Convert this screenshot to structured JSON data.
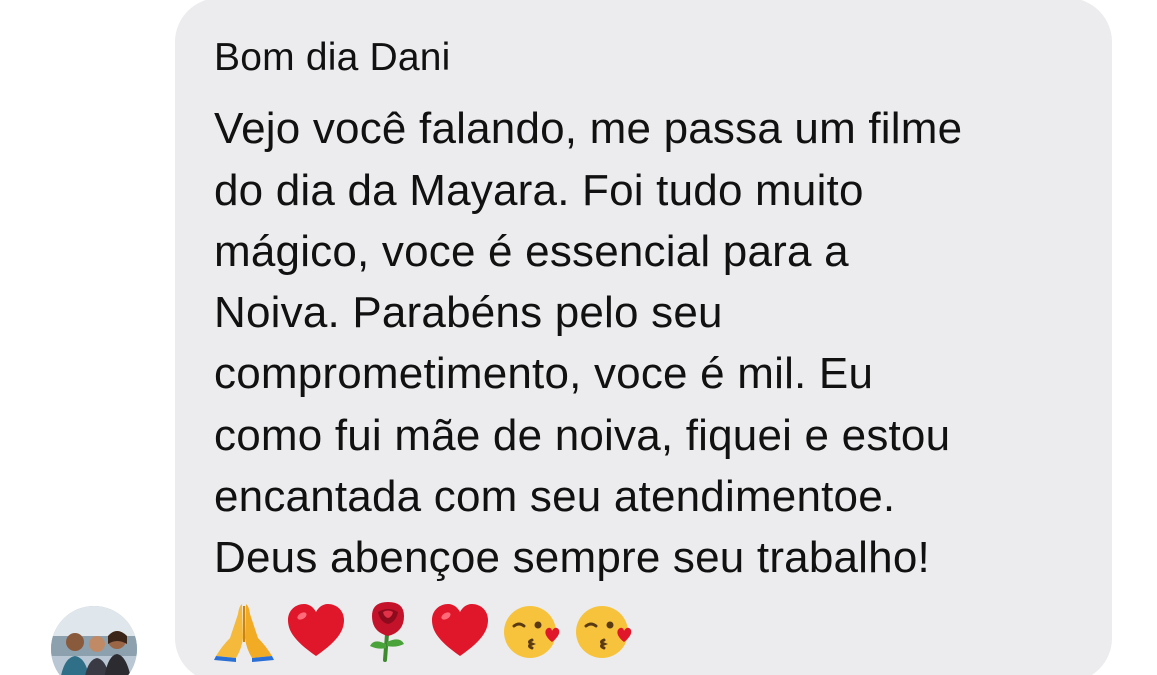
{
  "message": {
    "greeting": "Bom dia Dani",
    "lines": [
      "Vejo você falando, me passa um filme",
      "do dia da Mayara. Foi tudo muito",
      "mágico, voce é essencial para a",
      "Noiva. Parabéns pelo seu",
      "comprometimento, voce é mil. Eu",
      "como fui mãe de noiva, fiquei e estou",
      "encantada com seu atendimentoe.",
      "Deus abençoe sempre seu trabalho!"
    ],
    "emojis": [
      "praying-hands",
      "red-heart",
      "red-rose",
      "red-heart",
      "face-blowing-kiss",
      "face-blowing-kiss"
    ]
  },
  "colors": {
    "bubble": "#ececee",
    "text": "#111111",
    "heart": "#e0162b",
    "emoji_face": "#f7c33d"
  }
}
